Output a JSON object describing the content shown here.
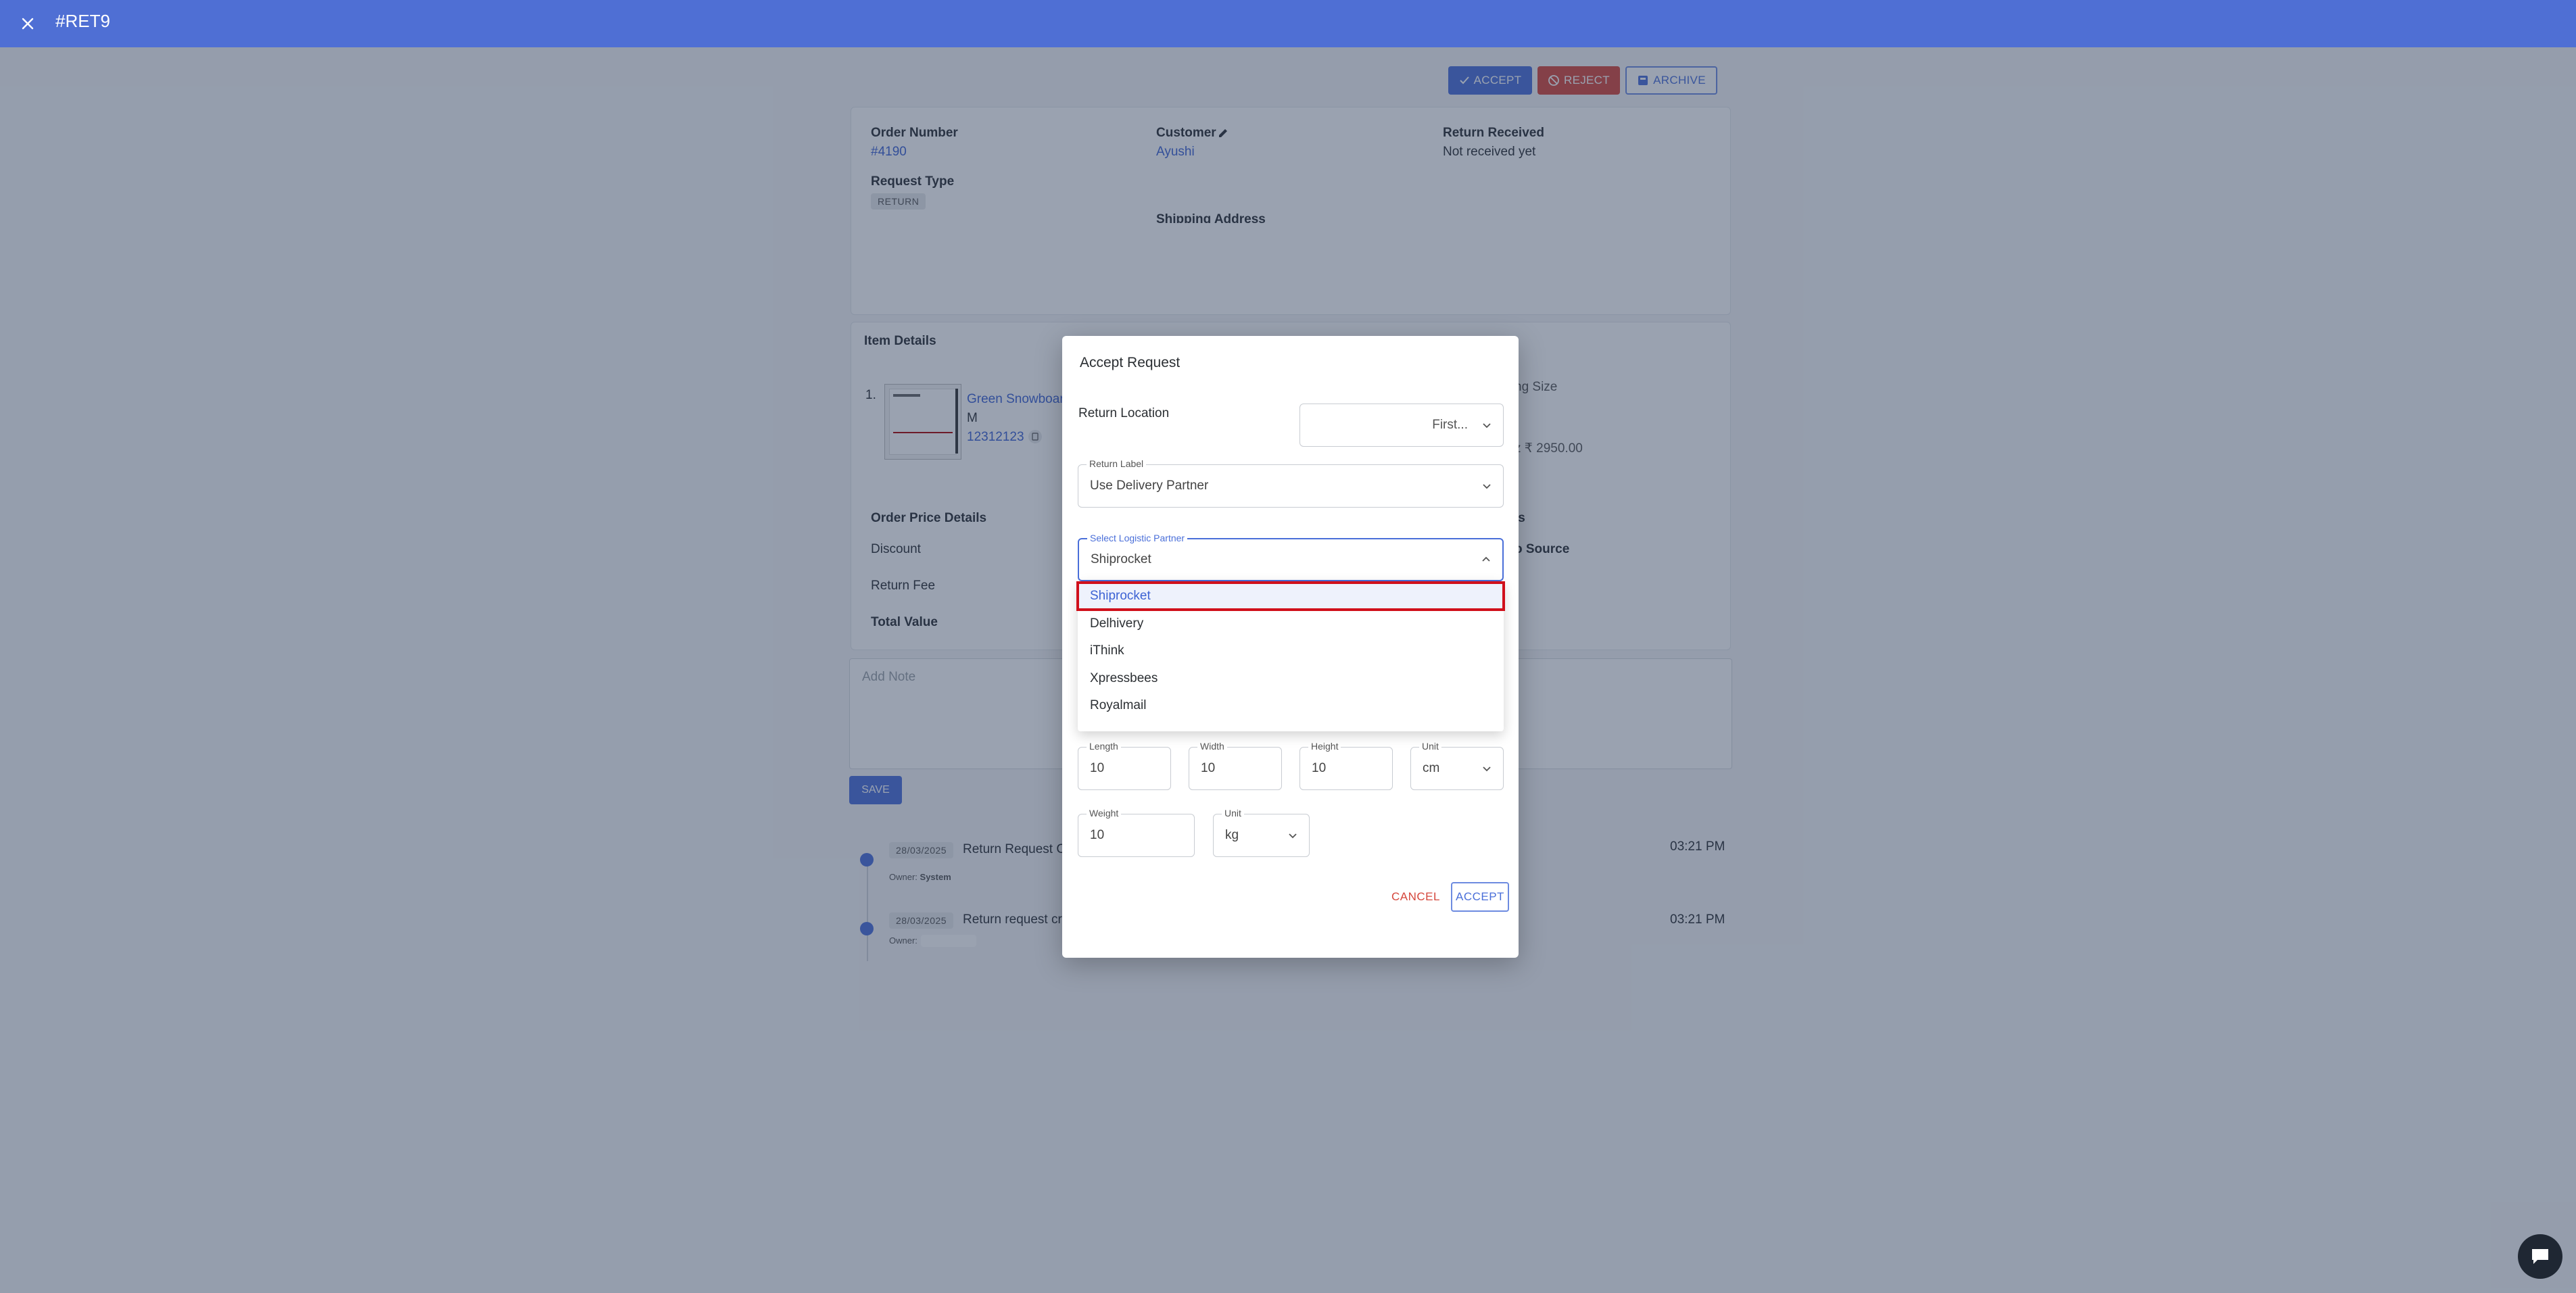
{
  "header": {
    "title": "#RET9"
  },
  "actions": {
    "accept": "ACCEPT",
    "reject": "REJECT",
    "archive": "ARCHIVE"
  },
  "order": {
    "order_number_label": "Order Number",
    "order_number": "#4190",
    "request_type_label": "Request Type",
    "request_type": "RETURN",
    "customer_label": "Customer",
    "customer_name": "Ayushi",
    "shipping_label": "Shipping Address",
    "return_received_label": "Return Received",
    "return_received": "Not received yet"
  },
  "items": {
    "title": "Item Details",
    "index": "1.",
    "name": "Green Snowboar",
    "size": "M",
    "sku": "12312123",
    "right_label": "ng Size",
    "right_price": "z ₹ 2950.00"
  },
  "price": {
    "title": "Order Price Details",
    "discount": "Discount",
    "return_fee": "Return Fee",
    "total": "Total Value",
    "right_title": "ls",
    "right_source": "o Source"
  },
  "note": {
    "placeholder": "Add Note",
    "save": "SAVE"
  },
  "timeline": [
    {
      "date": "28/03/2025",
      "text": "Return Request C",
      "owner_label": "Owner:",
      "owner": "System",
      "time": "03:21 PM"
    },
    {
      "date": "28/03/2025",
      "text": "Return request cr",
      "owner_label": "Owner:",
      "owner": "",
      "time": "03:21 PM"
    }
  ],
  "modal": {
    "title": "Accept Request",
    "return_location_label": "Return Location",
    "return_location_value": "First...",
    "return_label_label": "Return Label",
    "return_label_value": "Use Delivery Partner",
    "logistic_label": "Select Logistic Partner",
    "logistic_value": "Shiprocket",
    "options": [
      "Shiprocket",
      "Delhivery",
      "iThink",
      "Xpressbees",
      "Royalmail"
    ],
    "length_label": "Length",
    "length_value": "10",
    "width_label": "Width",
    "width_value": "10",
    "height_label": "Height",
    "height_value": "10",
    "dim_unit_label": "Unit",
    "dim_unit_value": "cm",
    "weight_label": "Weight",
    "weight_value": "10",
    "weight_unit_label": "Unit",
    "weight_unit_value": "kg",
    "cancel": "CANCEL",
    "accept": "ACCEPT"
  },
  "colors": {
    "primary": "#4f6fd4",
    "danger": "#d5473c",
    "highlight": "#d0101b"
  },
  "icons": [
    "close-icon",
    "check-icon",
    "ban-icon",
    "archive-icon",
    "pencil-icon",
    "copy-icon",
    "chevron-down-icon",
    "chevron-up-icon",
    "chat-icon"
  ]
}
